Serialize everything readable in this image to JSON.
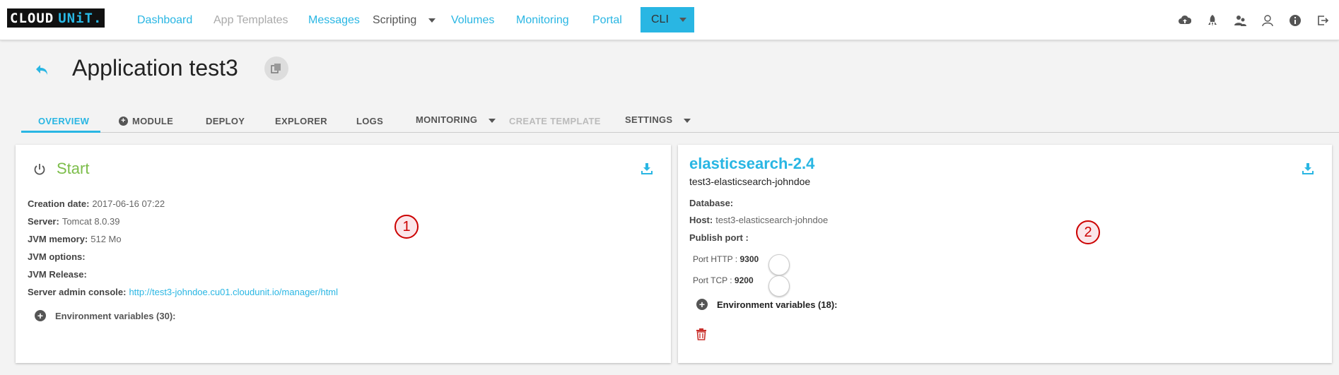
{
  "logo": {
    "part1": "CLOUD",
    "part2": "UNiT."
  },
  "nav": {
    "dashboard": "Dashboard",
    "app_templates": "App Templates",
    "messages": "Messages",
    "scripting": "Scripting",
    "volumes": "Volumes",
    "monitoring": "Monitoring",
    "portal": "Portal",
    "cli": "CLI"
  },
  "top_icons": [
    "cloud-upload-icon",
    "rocket-icon",
    "users-icon",
    "user-icon",
    "info-icon",
    "logout-icon"
  ],
  "page": {
    "title": "Application test3"
  },
  "tabs": {
    "overview": "OVERVIEW",
    "module": "MODULE",
    "deploy": "DEPLOY",
    "explorer": "EXPLORER",
    "logs": "LOGS",
    "monitoring": "MONITORING",
    "create_template": "CREATE TEMPLATE",
    "settings": "SETTINGS"
  },
  "server_card": {
    "status": "Start",
    "creation_date_label": "Creation date:",
    "creation_date": "2017-06-16 07:22",
    "server_label": "Server:",
    "server": "Tomcat 8.0.39",
    "jvm_memory_label": "JVM memory:",
    "jvm_memory": "512 Mo",
    "jvm_options_label": "JVM options:",
    "jvm_release_label": "JVM Release:",
    "admin_console_label": "Server admin console:",
    "admin_console_url": "http://test3-johndoe.cu01.cloudunit.io/manager/html",
    "env_vars": "Environment variables (30):",
    "marker": "1"
  },
  "module_card": {
    "name": "elasticsearch-2.4",
    "subtitle": "test3-elasticsearch-johndoe",
    "database_label": "Database:",
    "host_label": "Host:",
    "host": "test3-elasticsearch-johndoe",
    "publish_port_label": "Publish port :",
    "port_http_label": "Port HTTP :",
    "port_http": "9300",
    "port_tcp_label": "Port TCP :",
    "port_tcp": "9200",
    "env_vars": "Environment variables (18):",
    "marker": "2"
  },
  "colors": {
    "accent": "#29b6e3",
    "start_green": "#7cbd4a",
    "delete_red": "#c9302c",
    "marker_red": "#cc0000"
  }
}
